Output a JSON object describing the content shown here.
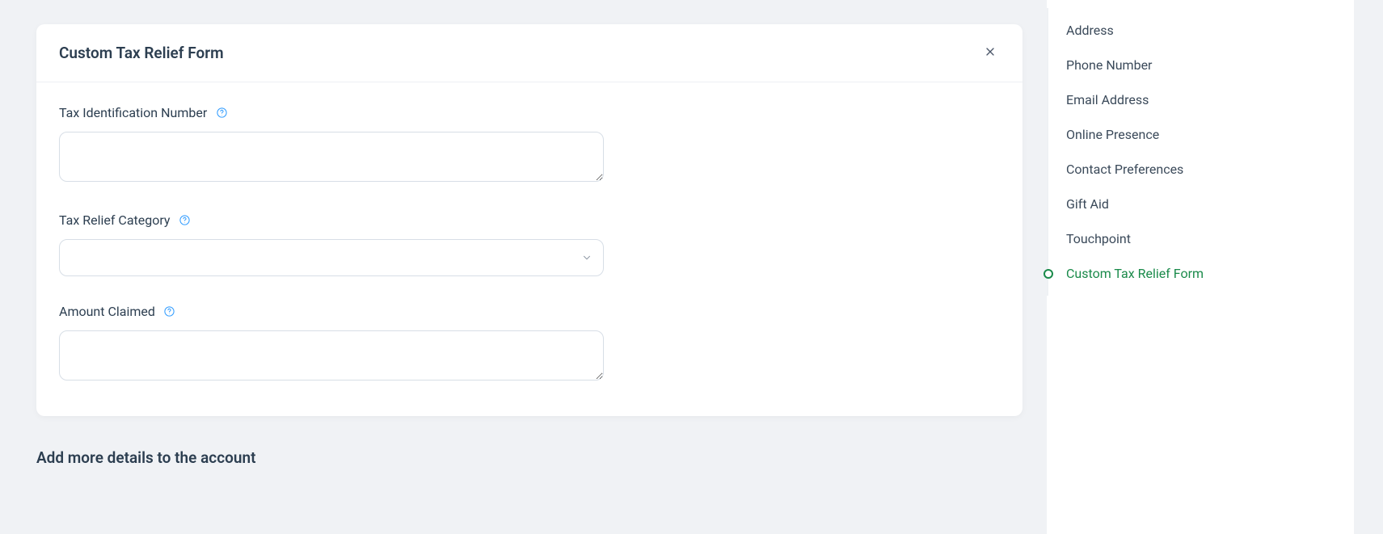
{
  "card": {
    "title": "Custom Tax Relief Form",
    "fields": {
      "tin": {
        "label": "Tax Identification Number",
        "value": ""
      },
      "category": {
        "label": "Tax Relief Category",
        "value": ""
      },
      "amount": {
        "label": "Amount Claimed",
        "value": ""
      }
    }
  },
  "section_heading": "Add more details to the account",
  "sidebar": {
    "items": [
      {
        "label": "Address",
        "active": false
      },
      {
        "label": "Phone Number",
        "active": false
      },
      {
        "label": "Email Address",
        "active": false
      },
      {
        "label": "Online Presence",
        "active": false
      },
      {
        "label": "Contact Preferences",
        "active": false
      },
      {
        "label": "Gift Aid",
        "active": false
      },
      {
        "label": "Touchpoint",
        "active": false
      },
      {
        "label": "Custom Tax Relief Form",
        "active": true
      }
    ]
  }
}
